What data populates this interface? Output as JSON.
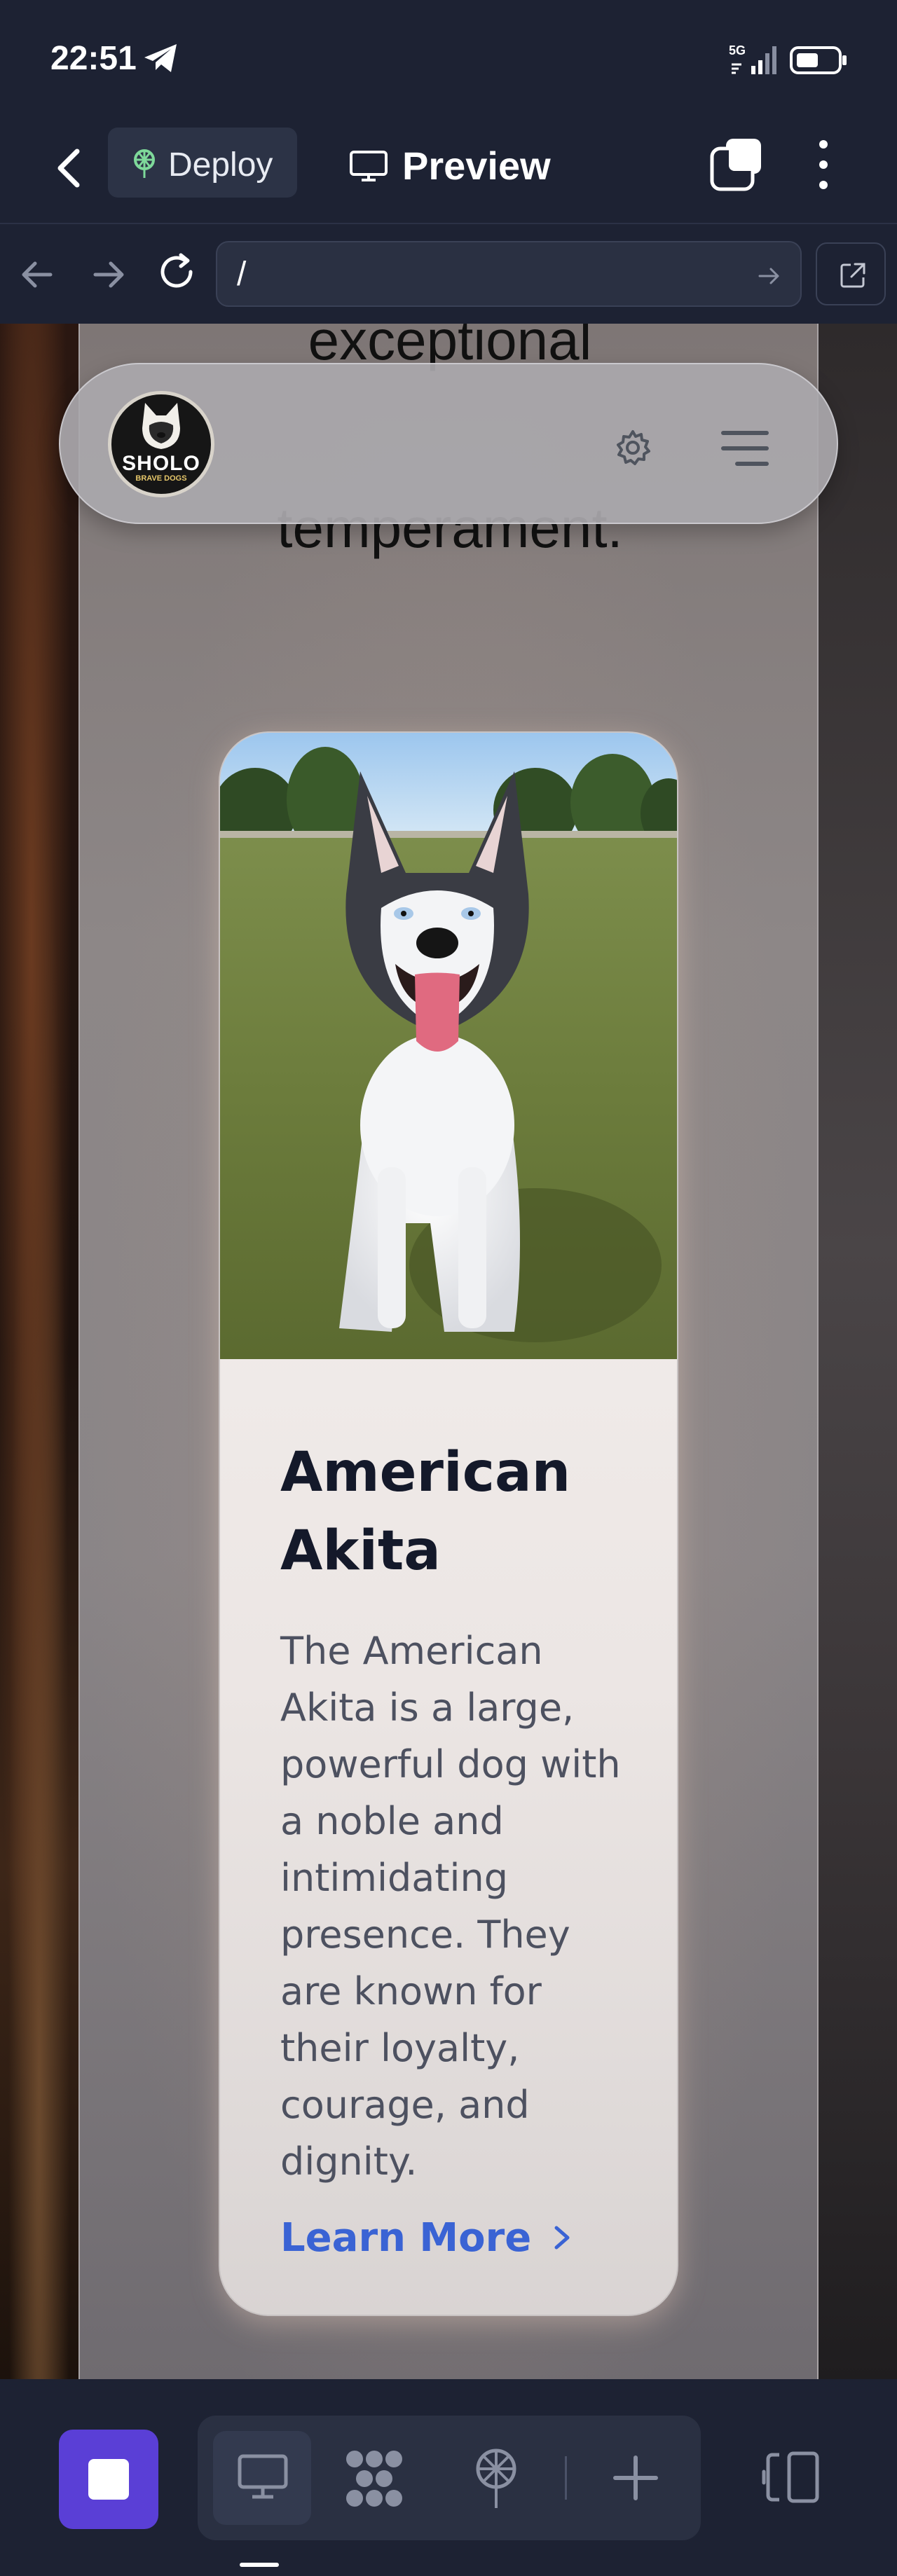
{
  "status_bar": {
    "time": "22:51",
    "network": "5G"
  },
  "app_toolbar": {
    "deploy_label": "Deploy",
    "preview_label": "Preview"
  },
  "url_bar": {
    "url": "/"
  },
  "page": {
    "fragment_top": "exceptional",
    "fragment_bottom": "temperament.",
    "logo": {
      "name": "SHOLO",
      "tagline": "BRAVE DOGS"
    }
  },
  "card": {
    "title": "American Akita",
    "description": "The American Akita is a large, powerful dog with a noble and intimidating presence. They are known for their loyalty, courage, and dignity.",
    "cta_label": "Learn More"
  },
  "icons": {
    "status": [
      "telegram-icon",
      "signal-icon",
      "battery-icon"
    ],
    "toolbar": [
      "back-icon",
      "deploy-icon",
      "monitor-icon",
      "tabs-icon",
      "more-icon"
    ],
    "browser": [
      "arrow-left-icon",
      "arrow-right-icon",
      "reload-icon",
      "go-icon",
      "external-link-icon"
    ],
    "site": [
      "gear-icon",
      "hamburger-icon",
      "chevron-right-icon"
    ],
    "bottom": [
      "stop-icon",
      "desktop-icon",
      "components-icon",
      "deploy-icon",
      "plus-icon",
      "split-view-icon"
    ]
  },
  "colors": {
    "app_bg": "#1d2233",
    "accent_purple": "#5a3fd6",
    "link_blue": "#3a63d4",
    "deploy_green": "#7ed99a",
    "title_text": "#14192a",
    "body_text": "#4d5160"
  }
}
